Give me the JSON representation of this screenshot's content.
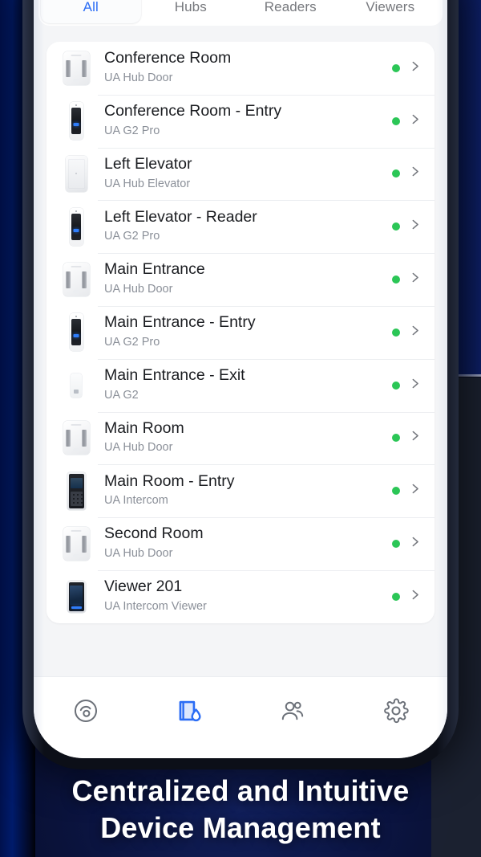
{
  "caption": {
    "line1": "Centralized and Intuitive",
    "line2": "Device Management"
  },
  "colors": {
    "accent": "#2a6cf5",
    "status_online": "#2bc656",
    "screen_bg": "#f4f5f7",
    "card_bg": "#ffffff",
    "title_text": "#1b1d21",
    "subtitle_text": "#8b9099",
    "inactive_tab_text": "#76787d",
    "nav_icon": "#6b7078",
    "caption_text": "#ffffff"
  },
  "tabs": [
    {
      "label": "All",
      "active": true
    },
    {
      "label": "Hubs",
      "active": false
    },
    {
      "label": "Readers",
      "active": false
    },
    {
      "label": "Viewers",
      "active": false
    }
  ],
  "devices": [
    {
      "name": "Conference Room",
      "model": "UA Hub Door",
      "status": "online",
      "thumb": "hub-door"
    },
    {
      "name": "Conference Room - Entry",
      "model": "UA G2 Pro",
      "status": "online",
      "thumb": "g2-pro"
    },
    {
      "name": "Left Elevator",
      "model": "UA Hub Elevator",
      "status": "online",
      "thumb": "hub-elevator"
    },
    {
      "name": "Left Elevator - Reader",
      "model": "UA G2 Pro",
      "status": "online",
      "thumb": "g2-pro"
    },
    {
      "name": "Main Entrance",
      "model": "UA Hub Door",
      "status": "online",
      "thumb": "hub-door"
    },
    {
      "name": "Main Entrance - Entry",
      "model": "UA G2 Pro",
      "status": "online",
      "thumb": "g2-pro"
    },
    {
      "name": "Main Entrance - Exit",
      "model": "UA G2",
      "status": "online",
      "thumb": "g2"
    },
    {
      "name": "Main Room",
      "model": "UA Hub Door",
      "status": "online",
      "thumb": "hub-door"
    },
    {
      "name": "Main Room - Entry",
      "model": "UA Intercom",
      "status": "online",
      "thumb": "intercom"
    },
    {
      "name": "Second Room",
      "model": "UA Hub Door",
      "status": "online",
      "thumb": "hub-door"
    },
    {
      "name": "Viewer 201",
      "model": "UA Intercom Viewer",
      "status": "online",
      "thumb": "intercom-viewer"
    }
  ],
  "bottom_nav": [
    {
      "icon": "activity-gauge-icon",
      "active": false
    },
    {
      "icon": "door-access-icon",
      "active": true
    },
    {
      "icon": "users-icon",
      "active": false
    },
    {
      "icon": "gear-icon",
      "active": false
    }
  ]
}
